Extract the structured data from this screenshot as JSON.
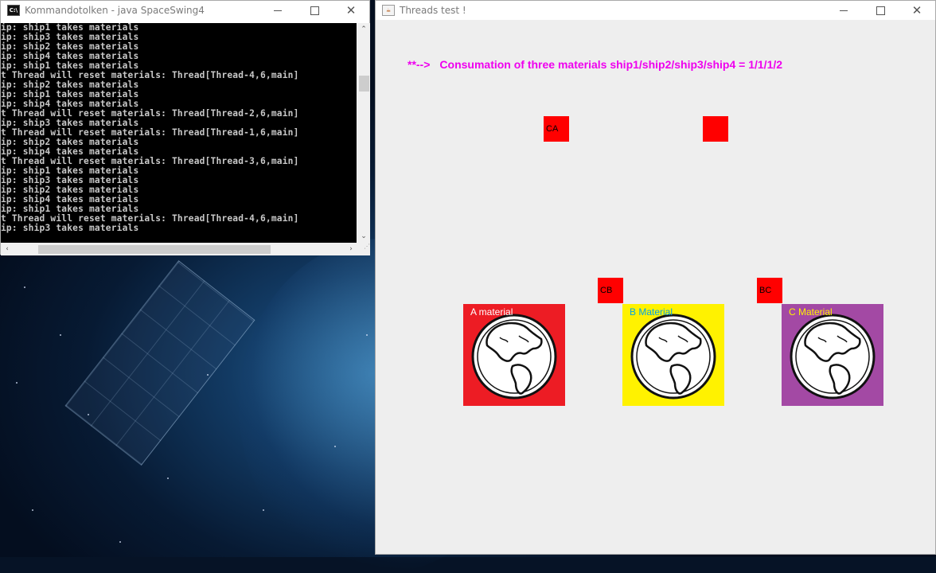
{
  "console_window": {
    "title": "Kommandotolken - java  SpaceSwing4",
    "icon": "cmd-icon",
    "lines": [
      "ip: ship1 takes materials",
      "ip: ship3 takes materials",
      "ip: ship2 takes materials",
      "ip: ship4 takes materials",
      "ip: ship1 takes materials",
      "t Thread will reset materials: Thread[Thread-4,6,main]",
      "ip: ship2 takes materials",
      "ip: ship1 takes materials",
      "ip: ship4 takes materials",
      "t Thread will reset materials: Thread[Thread-2,6,main]",
      "ip: ship3 takes materials",
      "t Thread will reset materials: Thread[Thread-1,6,main]",
      "ip: ship2 takes materials",
      "ip: ship4 takes materials",
      "t Thread will reset materials: Thread[Thread-3,6,main]",
      "ip: ship1 takes materials",
      "ip: ship3 takes materials",
      "ip: ship2 takes materials",
      "ip: ship4 takes materials",
      "ip: ship1 takes materials",
      "t Thread will reset materials: Thread[Thread-4,6,main]",
      "ip: ship3 takes materials"
    ]
  },
  "app_window": {
    "title": "Threads test !",
    "icon": "java-icon",
    "status_arrow": "**-->",
    "status_text": "Consumation of three materials ship1/ship2/ship3/ship4 = 1/1/1/2",
    "ships": [
      {
        "label": "CA"
      },
      {
        "label": ""
      },
      {
        "label": "CB"
      },
      {
        "label": "BC"
      }
    ],
    "materials": [
      {
        "label": "A material",
        "bg": "#ed1c24",
        "label_color": "#ffffff"
      },
      {
        "label": "B Material",
        "bg": "#fff200",
        "label_color": "#00a2e8"
      },
      {
        "label": "C Material",
        "bg": "#a349a4",
        "label_color": "#fff200"
      }
    ]
  },
  "colors": {
    "status_text": "#ee00ee",
    "ship": "#ff0000"
  }
}
